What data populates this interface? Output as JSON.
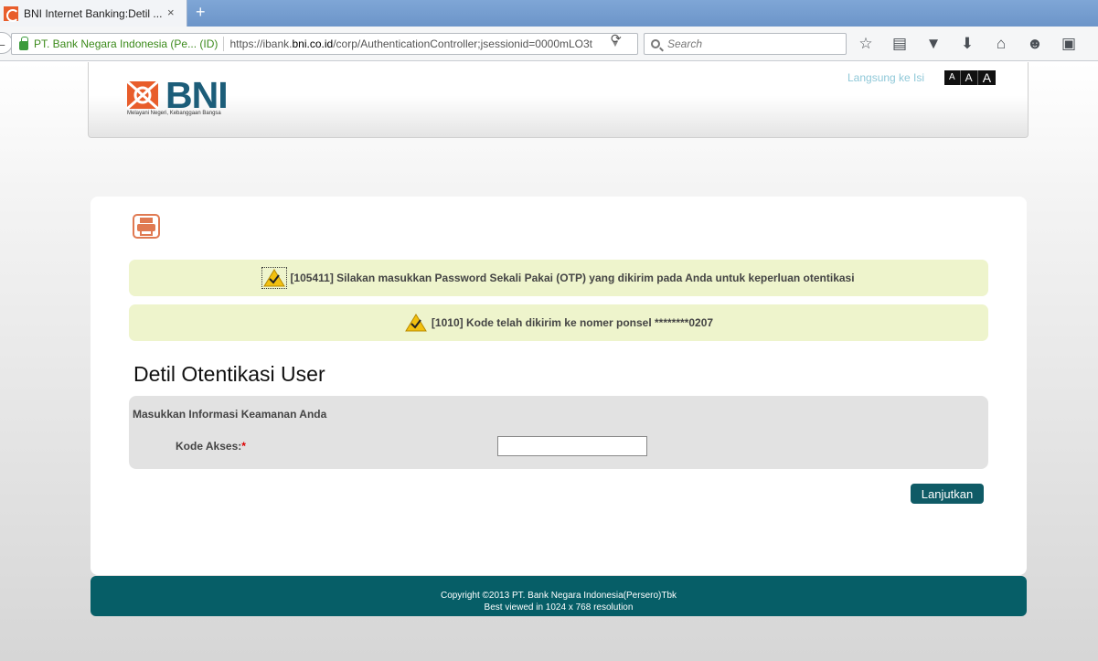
{
  "browser": {
    "tab_title": "BNI Internet Banking:Detil ...",
    "close_glyph": "×",
    "newtab_glyph": "+",
    "site_identity": "PT. Bank Negara Indonesia (Pe...  (ID)",
    "url_prefix": "https://ibank.",
    "url_domain": "bni.co.id",
    "url_path": "/corp/AuthenticationController;jsessionid=0000mLO3t",
    "search_placeholder": "Search",
    "icons": [
      "bookmark-star-icon",
      "reading-list-icon",
      "pocket-icon",
      "download-arrow-icon",
      "home-icon",
      "chat-icon",
      "downloads-icon",
      "extension-icon"
    ]
  },
  "header": {
    "logo_text": "BNI",
    "logo_tagline": "Melayani Negeri, Kebanggaan Bangsa",
    "skip_link": "Langsung ke Isi",
    "font_sizes": [
      "A",
      "A",
      "A"
    ]
  },
  "messages": [
    {
      "text": "[105411] Silakan masukkan Password Sekali Pakai (OTP) yang dikirim pada Anda untuk keperluan otentikasi"
    },
    {
      "text": "[1010] Kode telah dikirim ke nomer ponsel ********0207"
    }
  ],
  "form": {
    "title": "Detil Otentikasi User",
    "subtitle": "Masukkan Informasi Keamanan Anda",
    "field_label": "Kode Akses:",
    "required_mark": "*",
    "field_value": "",
    "submit_label": "Lanjutkan"
  },
  "footer": {
    "line1": "Copyright ©2013 PT. Bank Negara Indonesia(Persero)Tbk",
    "line2": "Best viewed in 1024 x 768 resolution"
  },
  "colors": {
    "brand_blue": "#1c5d79",
    "brand_orange": "#e85d2b",
    "teal": "#065e67",
    "message_bg": "#eef4cc"
  }
}
